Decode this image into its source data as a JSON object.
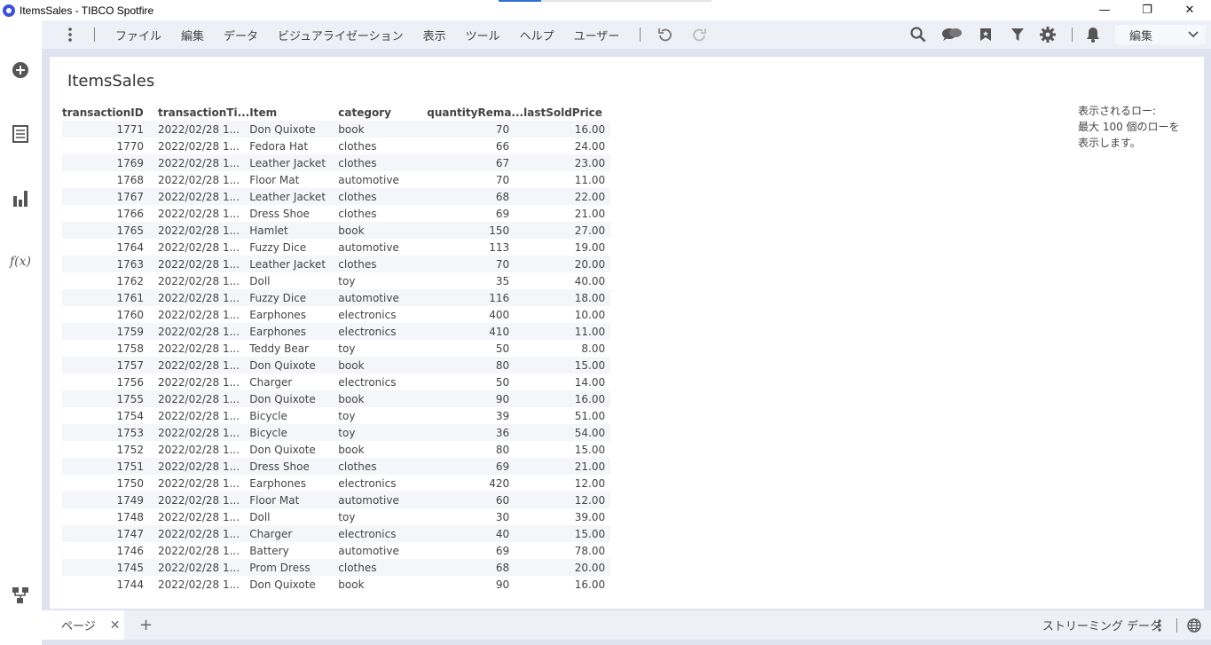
{
  "window": {
    "title": "ItemsSales - TIBCO Spotfire",
    "minimize": "—",
    "restore": "❐",
    "close": "✕"
  },
  "menu": {
    "items": [
      "ファイル",
      "編集",
      "データ",
      "ビジュアライゼーション",
      "表示",
      "ツール",
      "ヘルプ",
      "ユーザー"
    ],
    "edit_select": "編集"
  },
  "visualization": {
    "title": "ItemsSales",
    "note": [
      "表示されるロー:",
      "最大 100 個のローを",
      "表示します。"
    ],
    "columns": [
      "transactionID",
      "transactionTi...",
      "Item",
      "category",
      "quantityRema...",
      "lastSoldPrice"
    ],
    "rows": [
      [
        "1771",
        "2022/02/28 1...",
        "Don Quixote",
        "book",
        "70",
        "16.00"
      ],
      [
        "1770",
        "2022/02/28 1...",
        "Fedora Hat",
        "clothes",
        "66",
        "24.00"
      ],
      [
        "1769",
        "2022/02/28 1...",
        "Leather Jacket",
        "clothes",
        "67",
        "23.00"
      ],
      [
        "1768",
        "2022/02/28 1...",
        "Floor Mat",
        "automotive",
        "70",
        "11.00"
      ],
      [
        "1767",
        "2022/02/28 1...",
        "Leather Jacket",
        "clothes",
        "68",
        "22.00"
      ],
      [
        "1766",
        "2022/02/28 1...",
        "Dress Shoe",
        "clothes",
        "69",
        "21.00"
      ],
      [
        "1765",
        "2022/02/28 1...",
        "Hamlet",
        "book",
        "150",
        "27.00"
      ],
      [
        "1764",
        "2022/02/28 1...",
        "Fuzzy Dice",
        "automotive",
        "113",
        "19.00"
      ],
      [
        "1763",
        "2022/02/28 1...",
        "Leather Jacket",
        "clothes",
        "70",
        "20.00"
      ],
      [
        "1762",
        "2022/02/28 1...",
        "Doll",
        "toy",
        "35",
        "40.00"
      ],
      [
        "1761",
        "2022/02/28 1...",
        "Fuzzy Dice",
        "automotive",
        "116",
        "18.00"
      ],
      [
        "1760",
        "2022/02/28 1...",
        "Earphones",
        "electronics",
        "400",
        "10.00"
      ],
      [
        "1759",
        "2022/02/28 1...",
        "Earphones",
        "electronics",
        "410",
        "11.00"
      ],
      [
        "1758",
        "2022/02/28 1...",
        "Teddy Bear",
        "toy",
        "50",
        "8.00"
      ],
      [
        "1757",
        "2022/02/28 1...",
        "Don Quixote",
        "book",
        "80",
        "15.00"
      ],
      [
        "1756",
        "2022/02/28 1...",
        "Charger",
        "electronics",
        "50",
        "14.00"
      ],
      [
        "1755",
        "2022/02/28 1...",
        "Don Quixote",
        "book",
        "90",
        "16.00"
      ],
      [
        "1754",
        "2022/02/28 1...",
        "Bicycle",
        "toy",
        "39",
        "51.00"
      ],
      [
        "1753",
        "2022/02/28 1...",
        "Bicycle",
        "toy",
        "36",
        "54.00"
      ],
      [
        "1752",
        "2022/02/28 1...",
        "Don Quixote",
        "book",
        "80",
        "15.00"
      ],
      [
        "1751",
        "2022/02/28 1...",
        "Dress Shoe",
        "clothes",
        "69",
        "21.00"
      ],
      [
        "1750",
        "2022/02/28 1...",
        "Earphones",
        "electronics",
        "420",
        "12.00"
      ],
      [
        "1749",
        "2022/02/28 1...",
        "Floor Mat",
        "automotive",
        "60",
        "12.00"
      ],
      [
        "1748",
        "2022/02/28 1...",
        "Doll",
        "toy",
        "30",
        "39.00"
      ],
      [
        "1747",
        "2022/02/28 1...",
        "Charger",
        "electronics",
        "40",
        "15.00"
      ],
      [
        "1746",
        "2022/02/28 1...",
        "Battery",
        "automotive",
        "69",
        "78.00"
      ],
      [
        "1745",
        "2022/02/28 1...",
        "Prom Dress",
        "clothes",
        "68",
        "20.00"
      ],
      [
        "1744",
        "2022/02/28 1...",
        "Don Quixote",
        "book",
        "90",
        "16.00"
      ]
    ]
  },
  "bottom": {
    "page_tab": "ページ",
    "close_tab": "✕",
    "add_page": "+",
    "streaming": "ストリーミング データ"
  },
  "icons": {
    "left": [
      "add-circle-icon",
      "data-table-icon",
      "bar-chart-icon",
      "function-icon",
      "data-canvas-icon"
    ],
    "toolbar": [
      "kebab-icon",
      "undo-icon",
      "redo-icon",
      "search-icon",
      "collaboration-icon",
      "bookmark-icon",
      "filter-icon",
      "settings-icon",
      "notification-bell-icon",
      "chevron-down-icon",
      "globe-icon"
    ]
  },
  "colors": {
    "frame": "#dfe3ef",
    "bar": "#eef0f7",
    "accent": "#3f51d6"
  }
}
